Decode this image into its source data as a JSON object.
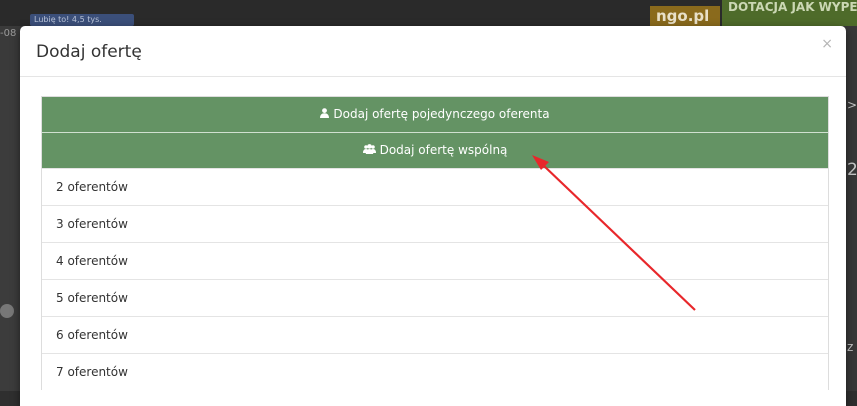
{
  "background": {
    "date_fragment": "-08",
    "fb_button_label": "Lubię to! 4,5 tys.",
    "logo_text": "ngo.pl",
    "banner_text": "DOTACJA JAK WYPEŁ",
    "right_chars": [
      ">",
      "2",
      "z"
    ]
  },
  "modal": {
    "title": "Dodaj ofertę",
    "close_label": "×"
  },
  "options": {
    "single": {
      "label": "Dodaj ofertę pojedynczego oferenta",
      "icon": "user-icon"
    },
    "joint": {
      "label": "Dodaj ofertę wspólną",
      "icon": "users-icon"
    }
  },
  "offerent_counts": [
    "2 oferentów",
    "3 oferentów",
    "4 oferentów",
    "5 oferentów",
    "6 oferentów",
    "7 oferentów"
  ],
  "annotation": {
    "type": "arrow",
    "color": "#e8272b"
  },
  "colors": {
    "green": "#649364",
    "accent_arrow": "#e8272b",
    "backdrop": "#2f2f2f"
  }
}
